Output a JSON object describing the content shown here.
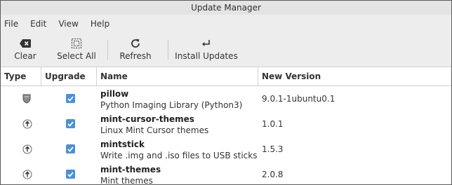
{
  "window": {
    "title": "Update Manager"
  },
  "menu": {
    "file": "File",
    "edit": "Edit",
    "view": "View",
    "help": "Help"
  },
  "toolbar": {
    "clear": "Clear",
    "select_all": "Select All",
    "refresh": "Refresh",
    "install_updates": "Install Updates"
  },
  "table": {
    "columns": {
      "type": "Type",
      "upgrade": "Upgrade",
      "name": "Name",
      "new_version": "New Version"
    },
    "rows": [
      {
        "name": "pillow",
        "description": "Python Imaging Library (Python3)",
        "version": "9.0.1-1ubuntu0.1",
        "type_icon": "security-shield-icon",
        "checked": true
      },
      {
        "name": "mint-cursor-themes",
        "description": "Linux Mint Cursor themes",
        "version": "1.0.1",
        "type_icon": "update-arrow-icon",
        "checked": true
      },
      {
        "name": "mintstick",
        "description": "Write .img and .iso files to USB sticks",
        "version": "1.5.3",
        "type_icon": "update-arrow-icon",
        "checked": true
      },
      {
        "name": "mint-themes",
        "description": "Mint themes",
        "version": "2.0.8",
        "type_icon": "update-arrow-icon",
        "checked": true
      }
    ]
  },
  "colors": {
    "checkbox": "#4a90d9",
    "toolbar_bg": "#ededed",
    "titlebar_bg": "#e4e4e4"
  }
}
